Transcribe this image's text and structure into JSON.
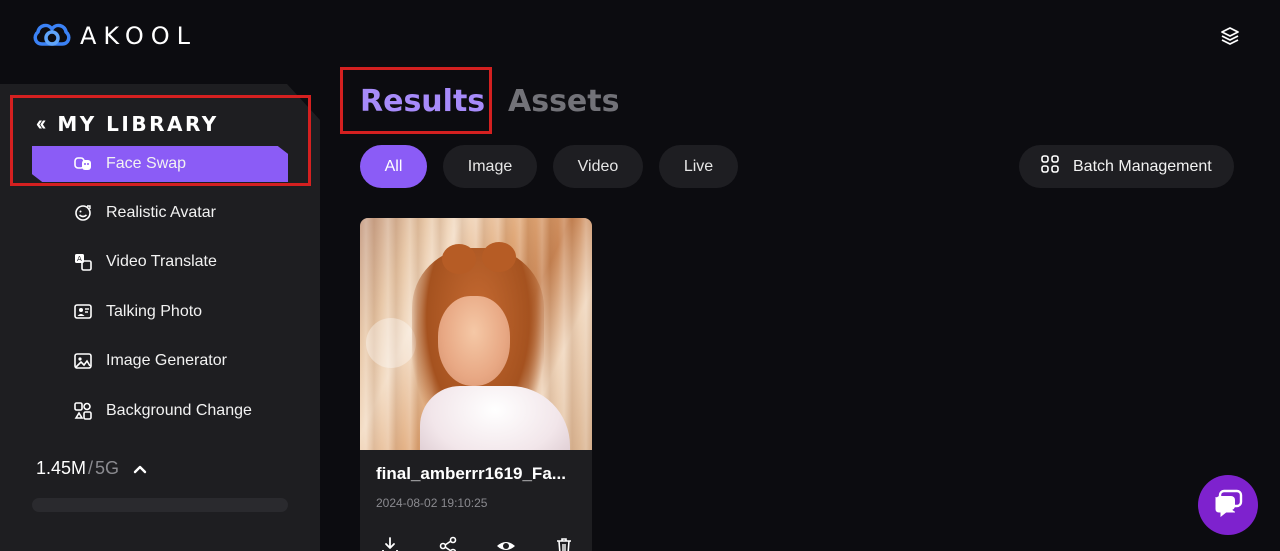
{
  "header": {
    "brand": "AKOOL",
    "logo_icon": "akool-cloud-icon",
    "layers_icon": "layers-icon"
  },
  "sidebar": {
    "title": "MY LIBRARY",
    "collapse_icon": "double-chevron-left-icon",
    "items": [
      {
        "label": "Face Swap",
        "icon": "face-swap-icon",
        "active": true
      },
      {
        "label": "Realistic Avatar",
        "icon": "avatar-icon",
        "active": false
      },
      {
        "label": "Video Translate",
        "icon": "translate-icon",
        "active": false
      },
      {
        "label": "Talking Photo",
        "icon": "talking-photo-icon",
        "active": false
      },
      {
        "label": "Image Generator",
        "icon": "image-icon",
        "active": false
      },
      {
        "label": "Background Change",
        "icon": "background-change-icon",
        "active": false
      }
    ],
    "storage": {
      "used": "1.45M",
      "separator": "/",
      "total": "5G"
    }
  },
  "main": {
    "tabs": [
      {
        "label": "Results",
        "active": true
      },
      {
        "label": "Assets",
        "active": false
      }
    ],
    "filters": [
      {
        "label": "All",
        "active": true
      },
      {
        "label": "Image",
        "active": false
      },
      {
        "label": "Video",
        "active": false
      },
      {
        "label": "Live",
        "active": false
      }
    ],
    "batch_label": "Batch Management",
    "cards": [
      {
        "title": "final_amberrr1619_Fa...",
        "date": "2024-08-02 19:10:25"
      }
    ]
  },
  "colors": {
    "accent": "#8b5cf6",
    "highlight_box": "#d42020",
    "chat_fab": "#7e22ce"
  }
}
